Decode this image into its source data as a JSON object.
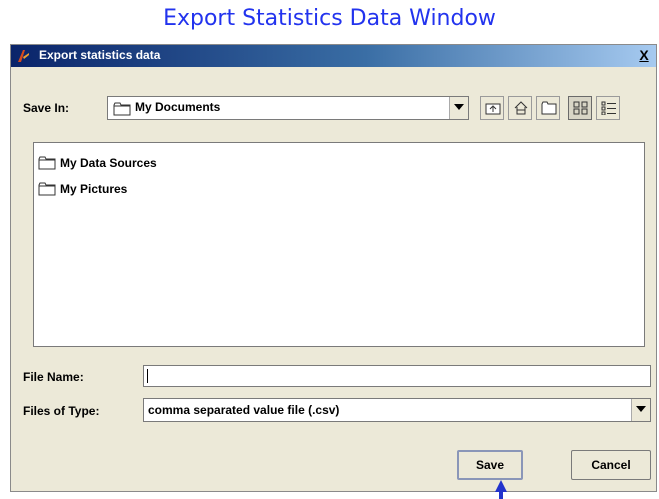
{
  "caption": "Export Statistics Data Window",
  "dialog": {
    "title": "Export statistics data",
    "close_glyph": "X"
  },
  "save_in": {
    "label": "Save In:",
    "value": "My Documents"
  },
  "toolbar_icons": [
    "up-one-level-icon",
    "home-icon",
    "new-folder-icon",
    "list-view-icon",
    "details-view-icon"
  ],
  "file_list": {
    "items": [
      {
        "name": "My Data Sources",
        "icon": "folder-icon"
      },
      {
        "name": "My Pictures",
        "icon": "folder-icon"
      }
    ]
  },
  "file_name": {
    "label": "File Name:",
    "value": ""
  },
  "file_type": {
    "label": "Files of Type:",
    "value": "comma separated value file (.csv)"
  },
  "buttons": {
    "save": "Save",
    "cancel": "Cancel"
  },
  "colors": {
    "caption": "#2233ee",
    "titlebar_start": "#0a246a",
    "titlebar_end": "#a6caf0",
    "dialog_bg": "#ece9d8",
    "pointer_arrow": "#2233cc"
  }
}
